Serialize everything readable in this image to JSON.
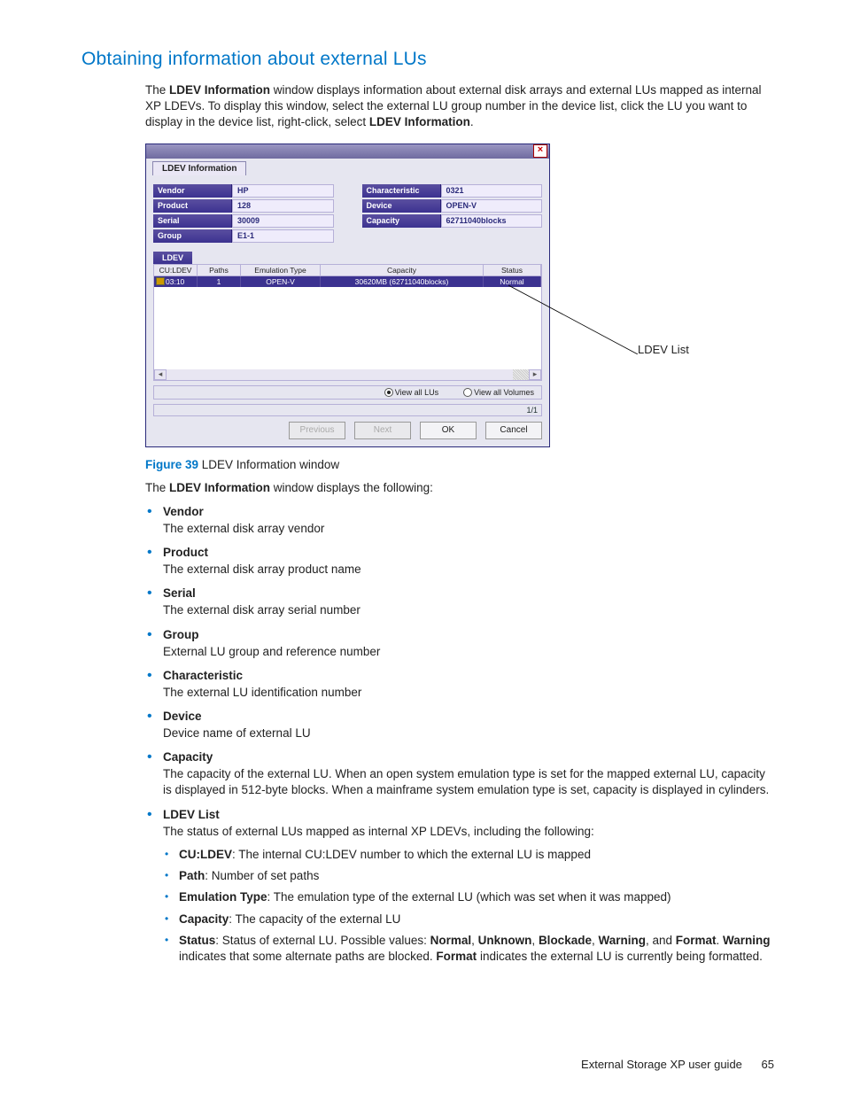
{
  "heading": "Obtaining information about external LUs",
  "intro": {
    "prefix": "The ",
    "bold1": "LDEV Information",
    "mid1": " window displays information about external disk arrays and external LUs mapped as internal XP LDEVs. To display this window, select the external LU group number in the device list, click the LU you want to display in the device list, right-click, select ",
    "bold2": "LDEV Information",
    "suffix": "."
  },
  "callout": "LDEV List",
  "window": {
    "tab": "LDEV Information",
    "left": {
      "vendor_k": "Vendor",
      "vendor_v": "HP",
      "product_k": "Product",
      "product_v": "128",
      "serial_k": "Serial",
      "serial_v": "30009",
      "group_k": "Group",
      "group_v": "E1-1"
    },
    "right": {
      "char_k": "Characteristic",
      "char_v": "0321",
      "device_k": "Device",
      "device_v": "OPEN-V",
      "capacity_k": "Capacity",
      "capacity_v": "62711040blocks"
    },
    "ldev_tab": "LDEV",
    "headers": {
      "cu": "CU:LDEV",
      "paths": "Paths",
      "emu": "Emulation Type",
      "cap": "Capacity",
      "status": "Status"
    },
    "row": {
      "cu": "03:10",
      "paths": "1",
      "emu": "OPEN-V",
      "cap": "30620MB (62711040blocks)",
      "status": "Normal"
    },
    "radios": {
      "all_lus": "View all LUs",
      "all_vols": "View all Volumes"
    },
    "pager": "1/1",
    "buttons": {
      "prev": "Previous",
      "next": "Next",
      "ok": "OK",
      "cancel": "Cancel"
    }
  },
  "figure": {
    "label": "Figure 39",
    "caption": " LDEV Information window"
  },
  "after_fig": {
    "prefix": "The ",
    "bold": "LDEV Information",
    "suffix": " window displays the following:"
  },
  "defs": [
    {
      "term": "Vendor",
      "desc": "The external disk array vendor"
    },
    {
      "term": "Product",
      "desc": "The external disk array product name"
    },
    {
      "term": "Serial",
      "desc": "The external disk array serial number"
    },
    {
      "term": "Group",
      "desc": "External LU group and reference number"
    },
    {
      "term": "Characteristic",
      "desc": "The external LU identification number"
    },
    {
      "term": "Device",
      "desc": "Device name of external LU"
    },
    {
      "term": "Capacity",
      "desc": "The capacity of the external LU. When an open system emulation type is set for the mapped external LU, capacity is displayed in 512-byte blocks. When a mainframe system emulation type is set, capacity is displayed in cylinders."
    }
  ],
  "ldev_list": {
    "term": "LDEV List",
    "intro": "The status of external LUs mapped as internal XP LDEVs, including the following:",
    "sub": [
      {
        "b": "CU:LDEV",
        "t": ": The internal CU:LDEV number to which the external LU is mapped"
      },
      {
        "b": "Path",
        "t": ": Number of set paths"
      },
      {
        "b": "Emulation Type",
        "t": ": The emulation type of the external LU (which was set when it was mapped)"
      },
      {
        "b": "Capacity",
        "t": ": The capacity of the external LU"
      }
    ],
    "status": {
      "b1": "Status",
      "t1": ": Status of external LU. Possible values: ",
      "b2": "Normal",
      "c2": ", ",
      "b3": "Unknown",
      "c3": ", ",
      "b4": "Blockade",
      "c4": ", ",
      "b5": "Warning",
      "c5": ", and ",
      "b6": "Format",
      "c6": ". ",
      "b7": "Warning",
      "t7": " indicates that some alternate paths are blocked. ",
      "b8": "Format",
      "t8": " indicates the external LU is currently being formatted."
    }
  },
  "footer": {
    "title": "External Storage XP user guide",
    "page": "65"
  }
}
